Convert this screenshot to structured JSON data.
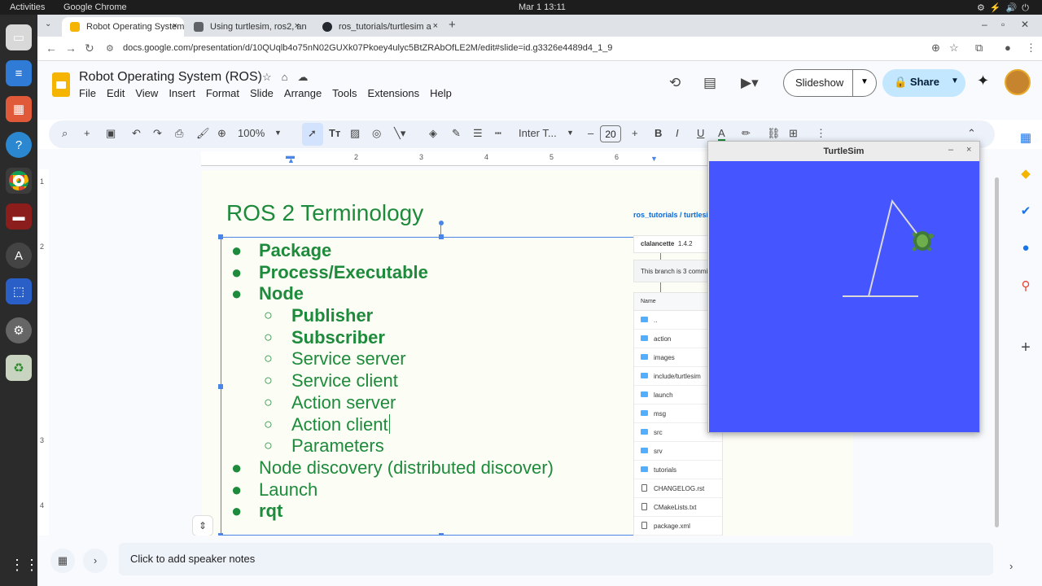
{
  "system": {
    "activities": "Activities",
    "app_name": "Google Chrome",
    "clock": "Mar 1  13:11"
  },
  "browser": {
    "tabs": [
      {
        "label": "Robot Operating System",
        "color": "#f4b400"
      },
      {
        "label": "Using turtlesim, ros2, an",
        "color": "#5f6368"
      },
      {
        "label": "ros_tutorials/turtlesim a",
        "color": "#24292f"
      }
    ],
    "tab_close": "×",
    "new_tab": "+",
    "url": "docs.google.com/presentation/d/10QUqlb4o75nN02GUXk07Pkoey4ulyc5BtZRAbOfLE2M/edit#slide=id.g3326e4489d4_1_9"
  },
  "slides_app": {
    "doc_title": "Robot Operating System (ROS)",
    "menu": [
      "File",
      "Edit",
      "View",
      "Insert",
      "Format",
      "Slide",
      "Arrange",
      "Tools",
      "Extensions",
      "Help"
    ],
    "slideshow_label": "Slideshow",
    "share_label": "Share",
    "zoom": "100%",
    "font_name": "Inter T...",
    "font_size": "20",
    "speaker_notes_placeholder": "Click to add speaker notes"
  },
  "ruler": {
    "h_ticks": [
      "1",
      "2",
      "3",
      "4",
      "5",
      "6"
    ],
    "v_ticks": [
      "1",
      "2",
      "3",
      "4"
    ]
  },
  "slide": {
    "title": "ROS 2 Terminology",
    "bullets": [
      {
        "text": "Package",
        "level": 0,
        "bold": true
      },
      {
        "text": "Process/Executable",
        "level": 0,
        "bold": true
      },
      {
        "text": "Node",
        "level": 0,
        "bold": true
      },
      {
        "text": "Publisher",
        "level": 1,
        "bold": true
      },
      {
        "text": "Subscriber",
        "level": 1,
        "bold": true
      },
      {
        "text": "Service server",
        "level": 1,
        "bold": false
      },
      {
        "text": "Service client",
        "level": 1,
        "bold": false
      },
      {
        "text": "Action server",
        "level": 1,
        "bold": false
      },
      {
        "text": "Action client",
        "level": 1,
        "bold": false
      },
      {
        "text": "Parameters",
        "level": 1,
        "bold": false
      },
      {
        "text": "Node discovery (distributed discover)",
        "level": 0,
        "bold": false
      },
      {
        "text": "Launch",
        "level": 0,
        "bold": false
      },
      {
        "text": "rqt",
        "level": 0,
        "bold": true
      }
    ],
    "bullet_marks": {
      "level0": "●",
      "level1": "○"
    },
    "github": {
      "breadcrumb": "ros_tutorials / turtlesim",
      "author": "clalancette",
      "version": "1.4.2",
      "branch_text": "This branch is 3 commits",
      "name_header": "Name",
      "files": [
        {
          "name": "..",
          "type": "dir"
        },
        {
          "name": "action",
          "type": "dir"
        },
        {
          "name": "images",
          "type": "dir"
        },
        {
          "name": "include/turtlesim",
          "type": "dir"
        },
        {
          "name": "launch",
          "type": "dir"
        },
        {
          "name": "msg",
          "type": "dir"
        },
        {
          "name": "src",
          "type": "dir"
        },
        {
          "name": "srv",
          "type": "dir"
        },
        {
          "name": "tutorials",
          "type": "dir"
        },
        {
          "name": "CHANGELOG.rst",
          "type": "file"
        },
        {
          "name": "CMakeLists.txt",
          "type": "file"
        },
        {
          "name": "package.xml",
          "type": "file"
        }
      ]
    }
  },
  "turtlesim": {
    "title": "TurtleSim",
    "minimize": "–",
    "close": "×",
    "background": "#4555ff"
  },
  "colors": {
    "slide_text": "#1e8a3c",
    "accent": "#4a86e8",
    "share_bg": "#c2e7ff"
  }
}
